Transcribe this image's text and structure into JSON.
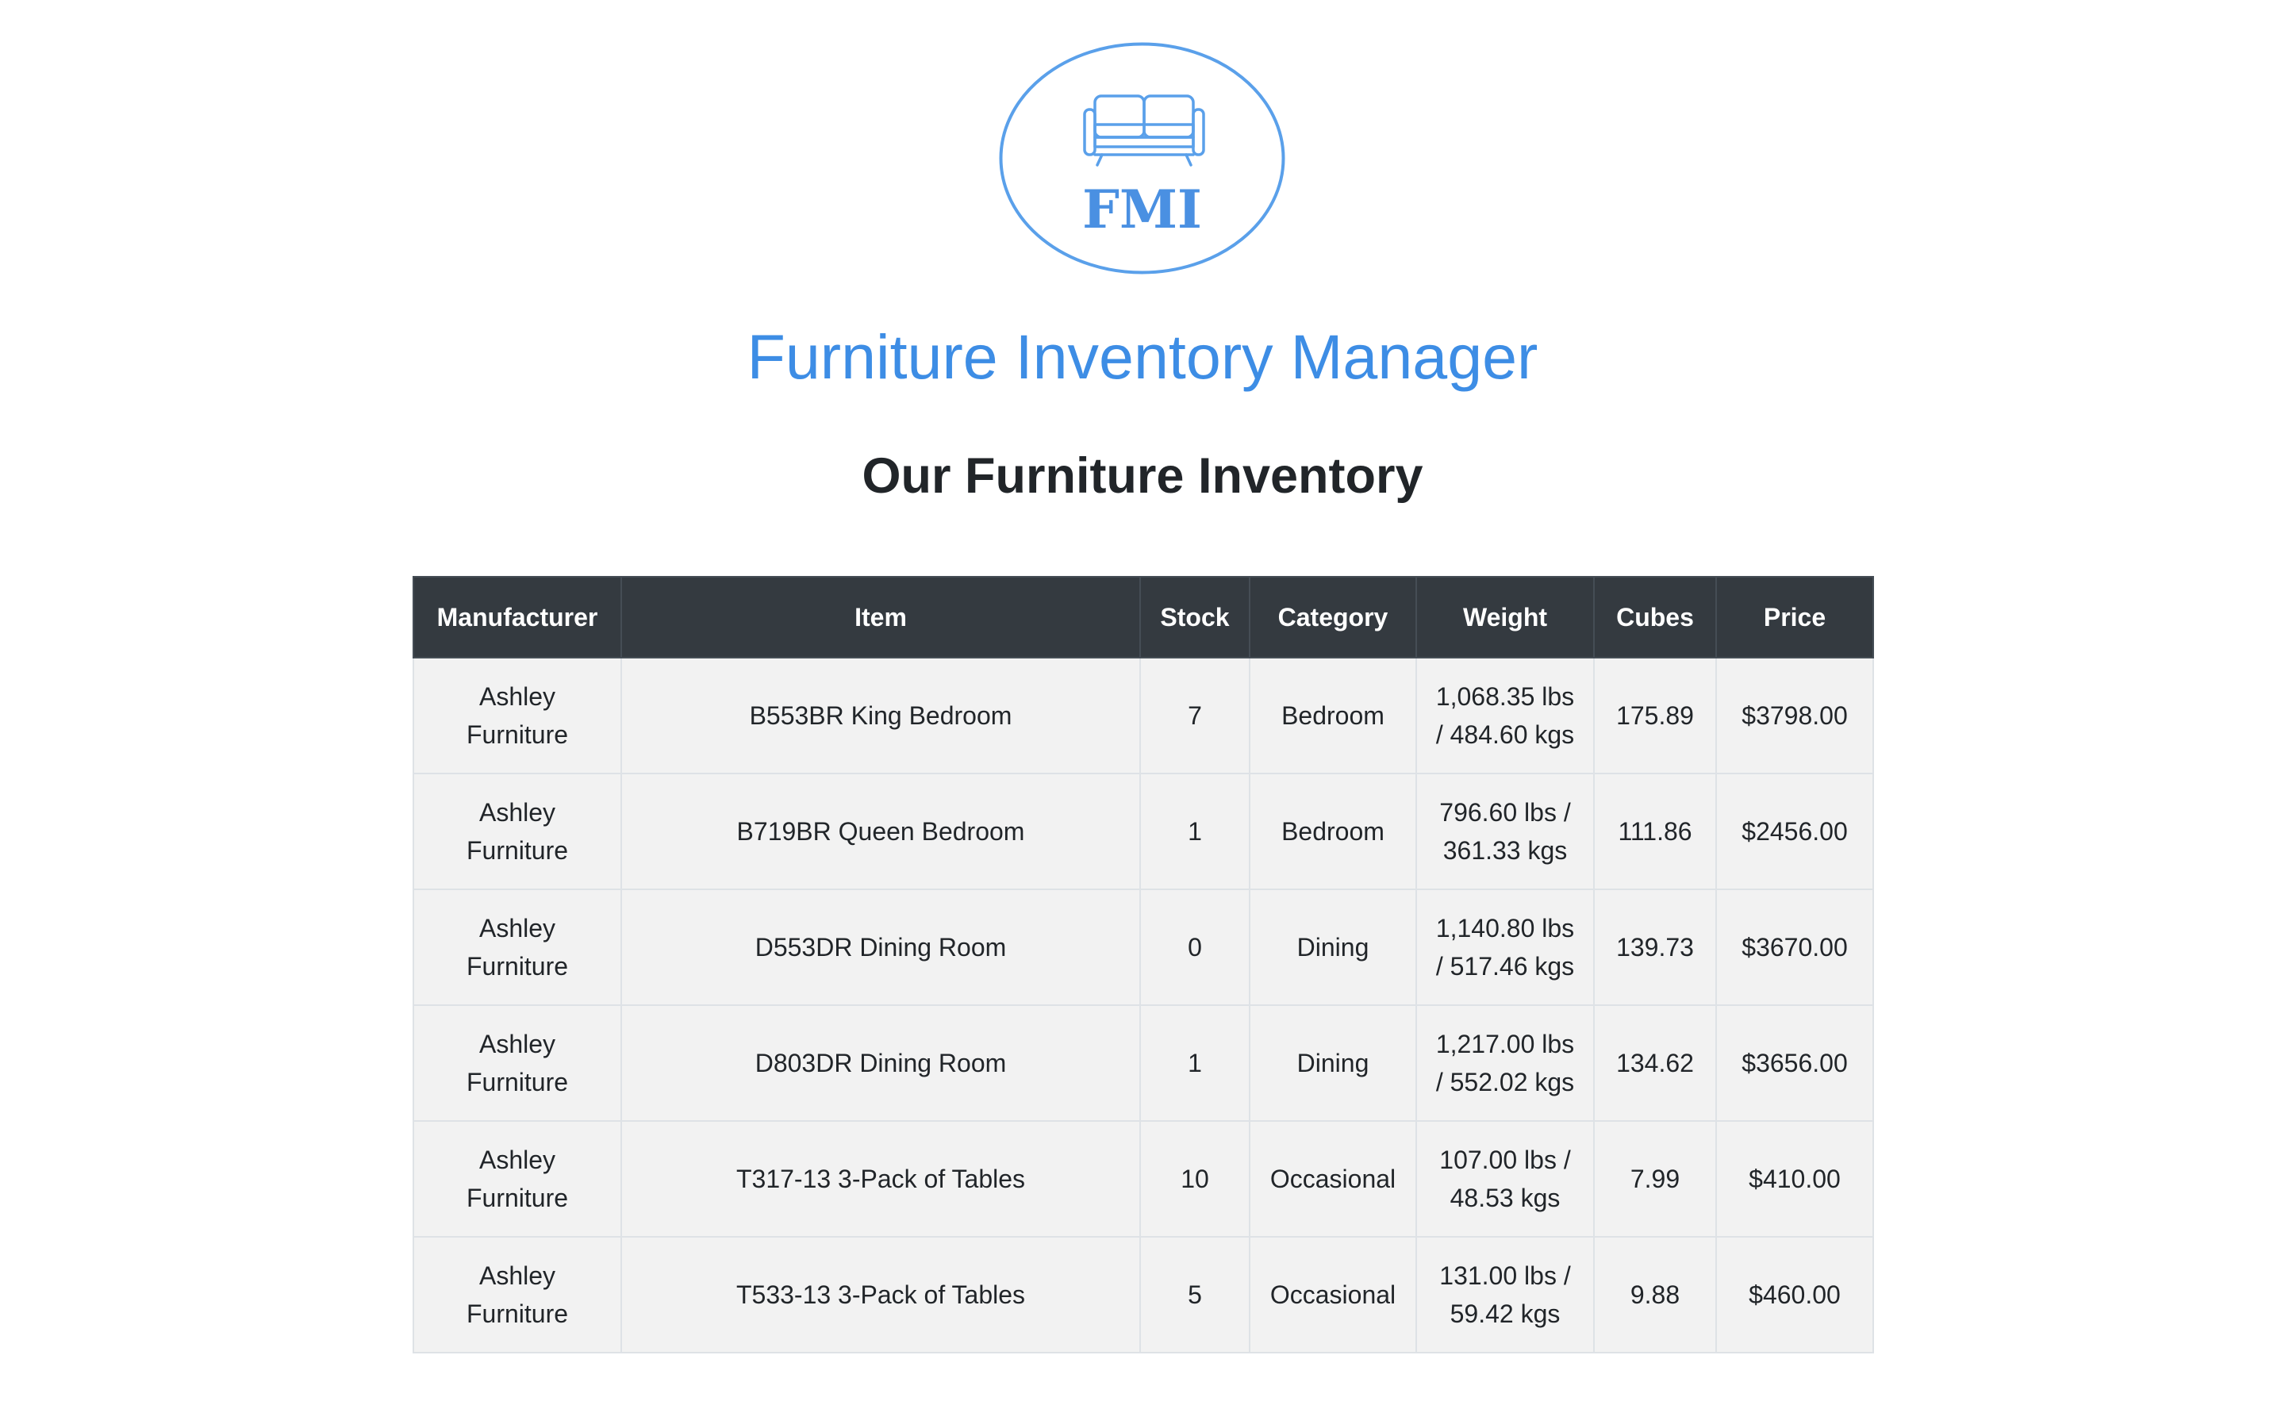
{
  "logo": {
    "text": "FMI",
    "icon": "sofa-icon",
    "color": "#4a90e2"
  },
  "header": {
    "title": "Furniture Inventory Manager",
    "subtitle": "Our Furniture Inventory"
  },
  "table": {
    "columns": [
      "Manufacturer",
      "Item",
      "Stock",
      "Category",
      "Weight",
      "Cubes",
      "Price"
    ],
    "rows": [
      {
        "manufacturer": "Ashley Furniture",
        "item": "B553BR King Bedroom",
        "stock": "7",
        "category": "Bedroom",
        "weight": "1,068.35 lbs / 484.60 kgs",
        "cubes": "175.89",
        "price": "$3798.00"
      },
      {
        "manufacturer": "Ashley Furniture",
        "item": "B719BR Queen Bedroom",
        "stock": "1",
        "category": "Bedroom",
        "weight": "796.60 lbs / 361.33 kgs",
        "cubes": "111.86",
        "price": "$2456.00"
      },
      {
        "manufacturer": "Ashley Furniture",
        "item": "D553DR Dining Room",
        "stock": "0",
        "category": "Dining",
        "weight": "1,140.80 lbs / 517.46 kgs",
        "cubes": "139.73",
        "price": "$3670.00"
      },
      {
        "manufacturer": "Ashley Furniture",
        "item": "D803DR Dining Room",
        "stock": "1",
        "category": "Dining",
        "weight": "1,217.00 lbs / 552.02 kgs",
        "cubes": "134.62",
        "price": "$3656.00"
      },
      {
        "manufacturer": "Ashley Furniture",
        "item": "T317-13 3-Pack of Tables",
        "stock": "10",
        "category": "Occasional",
        "weight": "107.00 lbs / 48.53 kgs",
        "cubes": "7.99",
        "price": "$410.00"
      },
      {
        "manufacturer": "Ashley Furniture",
        "item": "T533-13 3-Pack of Tables",
        "stock": "5",
        "category": "Occasional",
        "weight": "131.00 lbs / 59.42 kgs",
        "cubes": "9.88",
        "price": "$460.00"
      }
    ]
  },
  "colors": {
    "brand": "#3d8de5",
    "header_bg": "#343a40",
    "row_bg": "#f2f2f2"
  }
}
